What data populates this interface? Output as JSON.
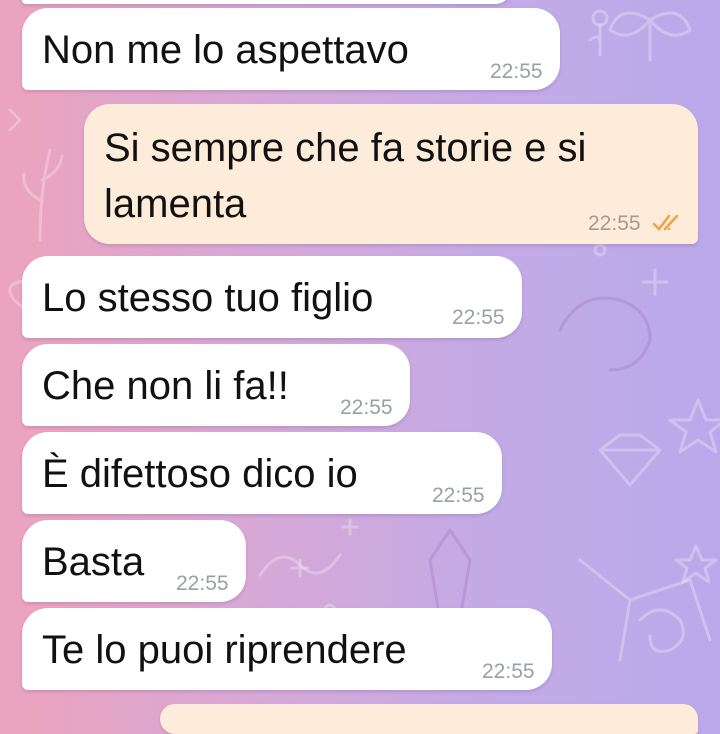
{
  "colors": {
    "incoming_bubble": "#ffffff",
    "outgoing_bubble": "#fdecd9",
    "read_ticks": "#f0a24a",
    "timestamp": "#9aa0a6"
  },
  "messages": [
    {
      "direction": "incoming",
      "text": "Non me lo aspettavo",
      "time": "22:55"
    },
    {
      "direction": "outgoing",
      "lines": [
        "Si sempre che fa storie e si",
        "lamenta"
      ],
      "time": "22:55",
      "status_icon": "double-check-icon"
    },
    {
      "direction": "incoming",
      "text": "Lo stesso tuo figlio",
      "time": "22:55"
    },
    {
      "direction": "incoming",
      "text": "Che non li fa!!",
      "time": "22:55"
    },
    {
      "direction": "incoming",
      "text": "È difettoso dico io",
      "time": "22:55"
    },
    {
      "direction": "incoming",
      "text": "Basta",
      "time": "22:55"
    },
    {
      "direction": "incoming",
      "text": "Te lo puoi riprendere",
      "time": "22:55"
    }
  ]
}
